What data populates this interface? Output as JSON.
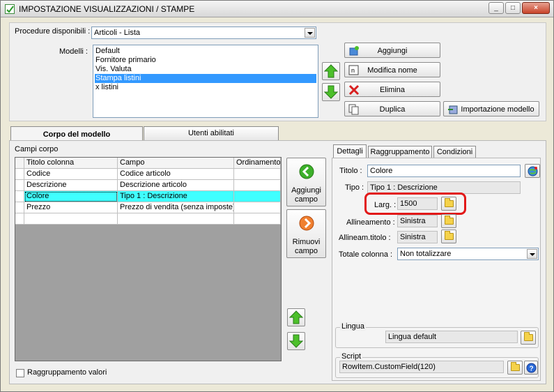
{
  "window": {
    "title": "IMPOSTAZIONE VISUALIZZAZIONI / STAMPE",
    "min_label": "_",
    "max_label": "□",
    "close_label": "×"
  },
  "top": {
    "procedure_label": "Procedure disponibili :",
    "procedure_value": "Articoli - Lista",
    "modelli_label": "Modelli :",
    "modelli": [
      "Default",
      "Fornitore primario",
      "Vis. Valuta",
      "Stampa listini",
      "x listini"
    ],
    "selected_index": 3,
    "buttons": {
      "aggiungi": "Aggiungi",
      "modifica": "Modifica nome",
      "elimina": "Elimina",
      "duplica": "Duplica",
      "importazione": "Importazione modello"
    }
  },
  "tabs": {
    "corpo": "Corpo del modello",
    "utenti": "Utenti abilitati"
  },
  "corpo": {
    "section_label": "Campi corpo",
    "columns": [
      "Titolo colonna",
      "Campo",
      "Ordinamento"
    ],
    "rows": [
      [
        "Codice",
        "Codice articolo",
        ""
      ],
      [
        "Descrizione",
        "Descrizione articolo",
        ""
      ],
      [
        "Colore",
        "Tipo 1 : Descrizione",
        ""
      ],
      [
        "Prezzo",
        "Prezzo di vendita (senza imposte)",
        ""
      ],
      [
        "",
        "",
        ""
      ]
    ],
    "selected_row": 2,
    "aggiungi_campo": [
      "Aggiungi",
      "campo"
    ],
    "rimuovi_campo": [
      "Rimuovi",
      "campo"
    ],
    "raggruppamento_valori": "Raggruppamento valori"
  },
  "details": {
    "tabs": [
      "Dettagli",
      "Raggruppamento",
      "Condizioni"
    ],
    "titolo_label": "Titolo :",
    "titolo_value": "Colore",
    "tipo_label": "Tipo :",
    "tipo_value": "Tipo 1 : Descrizione",
    "larg_label": "Larg. :",
    "larg_value": "1500",
    "allineamento_label": "Allineamento :",
    "allineamento_value": "Sinistra",
    "allineam_titolo_label": "Allineam.titolo :",
    "allineam_titolo_value": "Sinistra",
    "totale_label": "Totale colonna :",
    "totale_value": "Non totalizzare",
    "lingua_group": "Lingua",
    "lingua_value": "Lingua default",
    "script_group": "Script",
    "script_value": "RowItem.CustomField(120)"
  },
  "colors": {
    "selection": "#3399ff",
    "grid_selected": "#40ffff",
    "highlight": "#e21818"
  }
}
